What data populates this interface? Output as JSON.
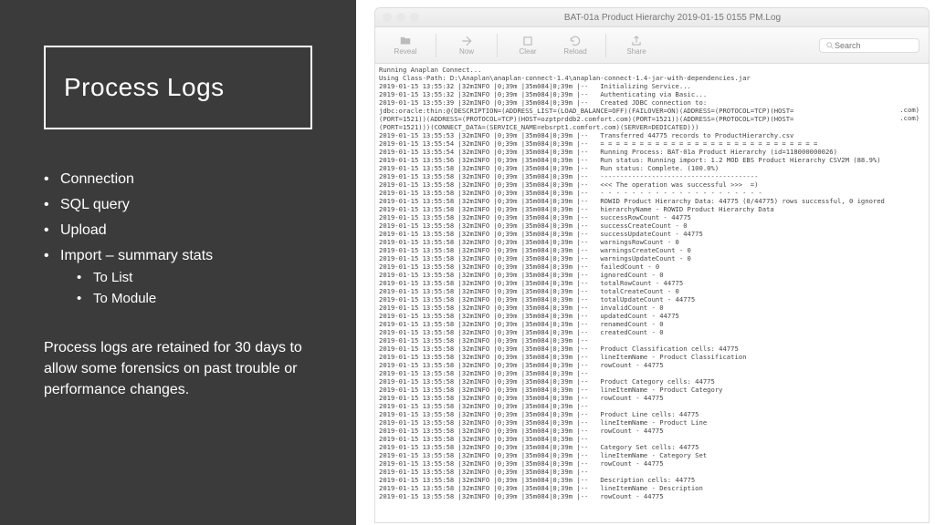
{
  "slide": {
    "title": "Process Logs",
    "bullets": [
      {
        "label": "Connection"
      },
      {
        "label": "SQL query"
      },
      {
        "label": "Upload"
      },
      {
        "label": "Import – summary stats",
        "sub": [
          "To List",
          "To Module"
        ]
      }
    ],
    "note": "Process logs are retained for 30 days to allow some forensics on past trouble or performance changes."
  },
  "window": {
    "title": "BAT-01a Product Hierarchy 2019-01-15 0155 PM.Log",
    "toolbar": {
      "reveal": "Reveal",
      "now": "Now",
      "clear": "Clear",
      "reload": "Reload",
      "share": "Share",
      "search_placeholder": "Search"
    },
    "host_suffix": ".com)",
    "log_lines": [
      "Running Anaplan Connect...",
      "Using Class-Path: D:\\Anaplan\\anaplan-connect-1.4\\anaplan-connect-1.4-jar-with-dependencies.jar",
      "2019-01-15 13:55:32 |32mINFO |0;39m |35m084|0;39m |--   Initializing Service...",
      "2019-01-15 13:55:32 |32mINFO |0;39m |35m084|0;39m |--   Authenticating via Basic...",
      "2019-01-15 13:55:39 |32mINFO |0;39m |35m084|0;39m |--   Created JDBC connection to:",
      "jdbc:oracle:thin:@(DESCRIPTION=(ADDRESS_LIST=(LOAD_BALANCE=OFF)(FAILOVER=ON)(ADDRESS=(PROTOCOL=TCP)(HOST=",
      "(PORT=1521))(ADDRESS=(PROTOCOL=TCP)(HOST=ozptprddb2.comfort.com)(PORT=1521))(ADDRESS=(PROTOCOL=TCP)(HOST=",
      "(PORT=1521)))(CONNECT_DATA=(SERVICE_NAME=ebsrpt1.comfort.com)(SERVER=DEDICATED)))",
      "2019-01-15 13:55:53 |32mINFO |0;39m |35m084|0;39m |--   Transferred 44775 records to ProductHierarchy.csv",
      "2019-01-15 13:55:54 |32mINFO |0;39m |35m084|0;39m |--   = = = = = = = = = = = = = = = = = = = = = = = = = = = =",
      "2019-01-15 13:55:54 |32mINFO |0;39m |35m084|0;39m |--   Running Process: BAT-01a Product Hierarchy (id=118000000026)",
      "2019-01-15 13:55:56 |32mINFO |0;39m |35m084|0;39m |--   Run status: Running import: 1.2 MOD EBS Product Hierarchy CSV2M (88.9%)",
      "2019-01-15 13:55:58 |32mINFO |0;39m |35m084|0;39m |--   Run status: Complete. (100.0%)",
      "2019-01-15 13:55:58 |32mINFO |0;39m |35m084|0;39m |--   ----------------------------------------",
      "2019-01-15 13:55:58 |32mINFO |0;39m |35m084|0;39m |--   <<< The operation was successful >>>  =)",
      "2019-01-15 13:55:58 |32mINFO |0;39m |35m084|0;39m |--   - - - - - - - - - - - - - - - - - - - - -",
      "2019-01-15 13:55:58 |32mINFO |0;39m |35m084|0;39m |--   ROWID Product Hierarchy Data: 44775 (0/44775) rows successful, 0 ignored",
      "2019-01-15 13:55:58 |32mINFO |0;39m |35m084|0;39m |--   hierarchyName - ROWID Product Hierarchy Data",
      "2019-01-15 13:55:58 |32mINFO |0;39m |35m084|0;39m |--   successRowCount - 44775",
      "2019-01-15 13:55:58 |32mINFO |0;39m |35m084|0;39m |--   successCreateCount - 0",
      "2019-01-15 13:55:58 |32mINFO |0;39m |35m084|0;39m |--   successUpdateCount - 44775",
      "2019-01-15 13:55:58 |32mINFO |0;39m |35m084|0;39m |--   warningsRowCount - 0",
      "2019-01-15 13:55:58 |32mINFO |0;39m |35m084|0;39m |--   warningsCreateCount - 0",
      "2019-01-15 13:55:58 |32mINFO |0;39m |35m084|0;39m |--   warningsUpdateCount - 0",
      "2019-01-15 13:55:58 |32mINFO |0;39m |35m084|0;39m |--   failedCount - 0",
      "2019-01-15 13:55:58 |32mINFO |0;39m |35m084|0;39m |--   ignoredCount - 0",
      "2019-01-15 13:55:58 |32mINFO |0;39m |35m084|0;39m |--   totalRowCount - 44775",
      "2019-01-15 13:55:58 |32mINFO |0;39m |35m084|0;39m |--   totalCreateCount - 0",
      "2019-01-15 13:55:58 |32mINFO |0;39m |35m084|0;39m |--   totalUpdateCount - 44775",
      "2019-01-15 13:55:58 |32mINFO |0;39m |35m084|0;39m |--   invalidCount - 0",
      "2019-01-15 13:55:58 |32mINFO |0;39m |35m084|0;39m |--   updatedCount - 44775",
      "2019-01-15 13:55:58 |32mINFO |0;39m |35m084|0;39m |--   renamedCount - 0",
      "2019-01-15 13:55:58 |32mINFO |0;39m |35m084|0;39m |--   createdCount - 0",
      "2019-01-15 13:55:58 |32mINFO |0;39m |35m084|0;39m |--",
      "2019-01-15 13:55:58 |32mINFO |0;39m |35m084|0;39m |--   Product Classification cells: 44775",
      "2019-01-15 13:55:58 |32mINFO |0;39m |35m084|0;39m |--   lineItemName - Product Classification",
      "2019-01-15 13:55:58 |32mINFO |0;39m |35m084|0;39m |--   rowCount - 44775",
      "2019-01-15 13:55:58 |32mINFO |0;39m |35m084|0;39m |--",
      "2019-01-15 13:55:58 |32mINFO |0;39m |35m084|0;39m |--   Product Category cells: 44775",
      "2019-01-15 13:55:58 |32mINFO |0;39m |35m084|0;39m |--   lineItemName - Product Category",
      "2019-01-15 13:55:58 |32mINFO |0;39m |35m084|0;39m |--   rowCount - 44775",
      "2019-01-15 13:55:58 |32mINFO |0;39m |35m084|0;39m |--",
      "2019-01-15 13:55:58 |32mINFO |0;39m |35m084|0;39m |--   Product Line cells: 44775",
      "2019-01-15 13:55:58 |32mINFO |0;39m |35m084|0;39m |--   lineItemName - Product Line",
      "2019-01-15 13:55:58 |32mINFO |0;39m |35m084|0;39m |--   rowCount - 44775",
      "2019-01-15 13:55:58 |32mINFO |0;39m |35m084|0;39m |--",
      "2019-01-15 13:55:58 |32mINFO |0;39m |35m084|0;39m |--   Category Set cells: 44775",
      "2019-01-15 13:55:58 |32mINFO |0;39m |35m084|0;39m |--   lineItemName - Category Set",
      "2019-01-15 13:55:58 |32mINFO |0;39m |35m084|0;39m |--   rowCount - 44775",
      "2019-01-15 13:55:58 |32mINFO |0;39m |35m084|0;39m |--",
      "2019-01-15 13:55:58 |32mINFO |0;39m |35m084|0;39m |--   Description cells: 44775",
      "2019-01-15 13:55:58 |32mINFO |0;39m |35m084|0;39m |--   lineItemName - Description",
      "2019-01-15 13:55:58 |32mINFO |0;39m |35m084|0;39m |--   rowCount - 44775"
    ]
  }
}
